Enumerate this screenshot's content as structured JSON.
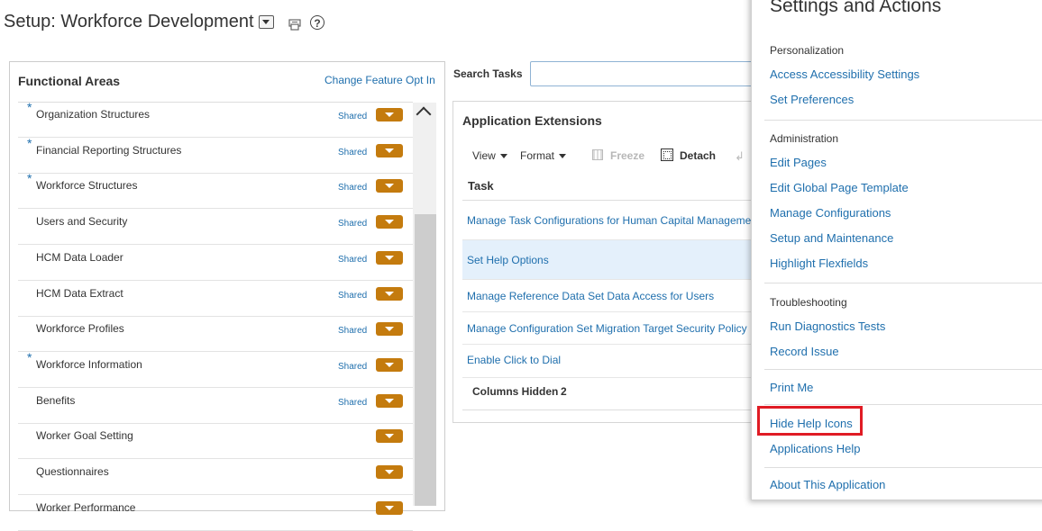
{
  "header": {
    "title": "Setup: Workforce Development"
  },
  "functional_areas": {
    "title": "Functional Areas",
    "change_link": "Change Feature Opt In",
    "items": [
      {
        "label": "Organization Structures",
        "required": true,
        "shared": "Shared"
      },
      {
        "label": "Financial Reporting Structures",
        "required": true,
        "shared": "Shared"
      },
      {
        "label": "Workforce Structures",
        "required": true,
        "shared": "Shared"
      },
      {
        "label": "Users and Security",
        "required": false,
        "shared": "Shared"
      },
      {
        "label": "HCM Data Loader",
        "required": false,
        "shared": "Shared"
      },
      {
        "label": "HCM Data Extract",
        "required": false,
        "shared": "Shared"
      },
      {
        "label": "Workforce Profiles",
        "required": false,
        "shared": "Shared"
      },
      {
        "label": "Workforce Information",
        "required": true,
        "shared": "Shared"
      },
      {
        "label": "Benefits",
        "required": false,
        "shared": "Shared"
      },
      {
        "label": "Worker Goal Setting",
        "required": false,
        "shared": ""
      },
      {
        "label": "Questionnaires",
        "required": false,
        "shared": ""
      },
      {
        "label": "Worker Performance",
        "required": false,
        "shared": ""
      }
    ],
    "required_marker": "*"
  },
  "search": {
    "label": "Search Tasks",
    "value": ""
  },
  "app_extensions": {
    "title": "Application Extensions",
    "toolbar": {
      "view": "View",
      "format": "Format",
      "freeze": "Freeze",
      "detach": "Detach"
    },
    "column_header": "Task",
    "tasks": [
      "Manage Task Configurations for Human Capital Management",
      "Set Help Options",
      "Manage Reference Data Set Data Access for Users",
      "Manage Configuration Set Migration Target Security Policy",
      "Enable Click to Dial"
    ],
    "selected_index": 1,
    "columns_hidden_label": "Columns Hidden",
    "columns_hidden_count": "2"
  },
  "settings": {
    "title": "Settings and Actions",
    "personalization": {
      "heading": "Personalization",
      "items": [
        "Access Accessibility Settings",
        "Set Preferences"
      ]
    },
    "administration": {
      "heading": "Administration",
      "items": [
        "Edit Pages",
        "Edit Global Page Template",
        "Manage Configurations",
        "Setup and Maintenance",
        "Highlight Flexfields"
      ]
    },
    "troubleshooting": {
      "heading": "Troubleshooting",
      "items": [
        "Run Diagnostics Tests",
        "Record Issue"
      ]
    },
    "print_me": "Print Me",
    "hide_help_icons": "Hide Help Icons",
    "applications_help": "Applications Help",
    "about": "About This Application"
  },
  "colors": {
    "link": "#1f6fad",
    "action_button": "#c47b0e",
    "selection": "#e4f0fb",
    "highlight": "#e01b24"
  }
}
